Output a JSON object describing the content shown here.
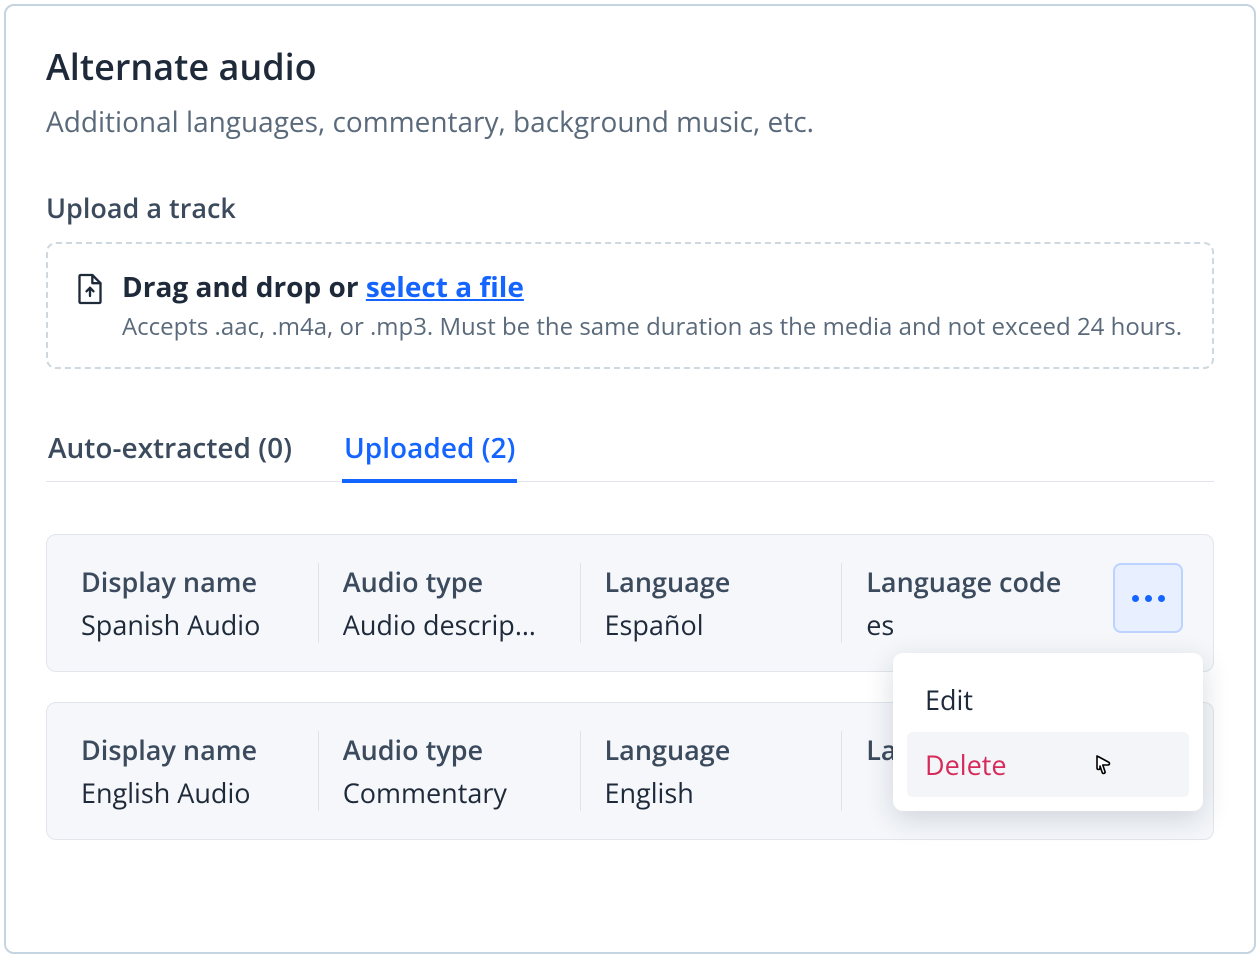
{
  "header": {
    "title": "Alternate audio",
    "subtitle": "Additional languages, commentary, background music, etc."
  },
  "upload": {
    "heading": "Upload a track",
    "prompt_prefix": "Drag and drop or ",
    "prompt_link": "select a file",
    "accepts": "Accepts .aac, .m4a, or .mp3. Must be the same duration as the media and not exceed 24 hours."
  },
  "tabs": {
    "auto_extracted": "Auto-extracted (0)",
    "uploaded": "Uploaded (2)"
  },
  "columns": {
    "display_name": "Display name",
    "audio_type": "Audio type",
    "language": "Language",
    "language_code": "Language code"
  },
  "tracks": [
    {
      "display_name": "Spanish Audio",
      "audio_type": "Audio descrip…",
      "language": "Español",
      "language_code": "es"
    },
    {
      "display_name": "English Audio",
      "audio_type": "Commentary",
      "language": "English",
      "language_code": ""
    }
  ],
  "menu": {
    "edit": "Edit",
    "delete": "Delete"
  }
}
